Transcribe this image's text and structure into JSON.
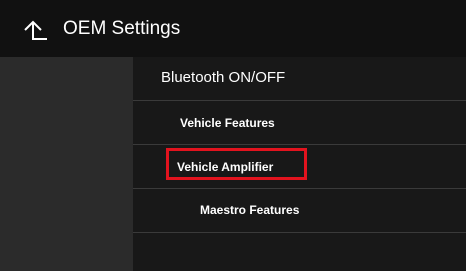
{
  "header": {
    "title": "OEM Settings",
    "back_icon": "back-arrow-icon"
  },
  "menu": {
    "items": [
      {
        "label": "Bluetooth ON/OFF"
      },
      {
        "label": "Vehicle Features"
      },
      {
        "label": "Vehicle Amplifier"
      },
      {
        "label": "Maestro Features"
      }
    ]
  },
  "colors": {
    "highlight": "#e2131e",
    "background": "#1d1d1d",
    "sidebar": "#2b2b2b"
  }
}
